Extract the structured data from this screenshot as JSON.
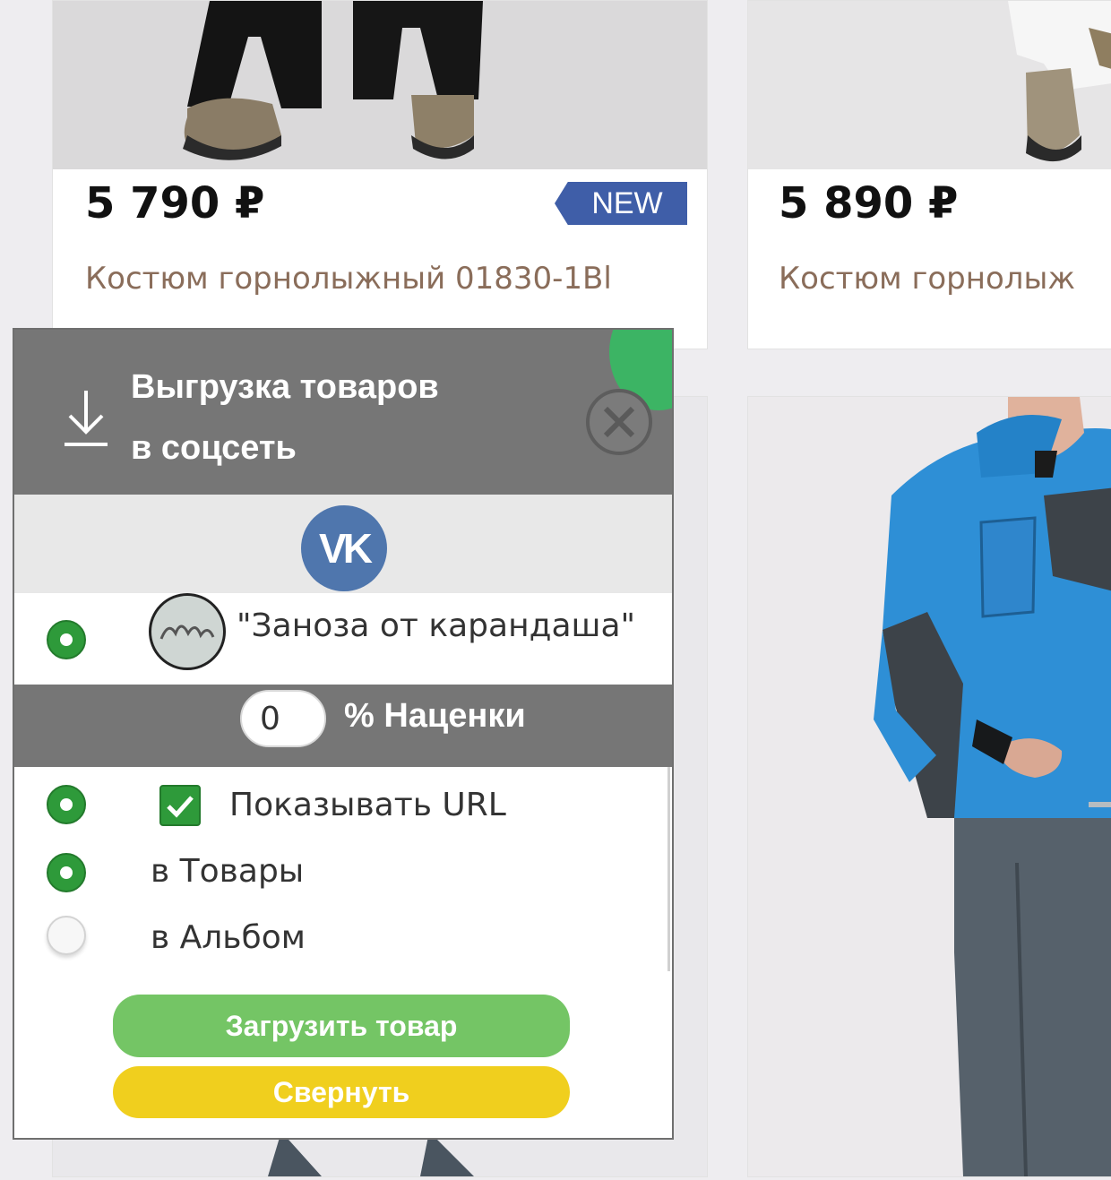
{
  "products": [
    {
      "price": "5 790 ₽",
      "name": "Костюм горнолыжный 01830-1Bl",
      "badge": "NEW"
    },
    {
      "price": "5 890 ₽",
      "name": "Костюм горнолыж"
    }
  ],
  "widget": {
    "title_line1": "Выгрузка товаров",
    "title_line2": "в соцсеть",
    "network_label": "VK",
    "group_name": "\"Заноза от карандаша\"",
    "markup_value": "0",
    "markup_label": "% Наценки",
    "show_url_label": "Показывать URL",
    "to_goods_label": "в Товары",
    "to_album_label": "в Альбом",
    "upload_button": "Загрузить товар",
    "collapse_button": "Свернуть"
  },
  "colors": {
    "header_gray": "#767676",
    "accent_green": "#2e9a3a",
    "upload_green": "#74c565",
    "collapse_yellow": "#f0cf1e",
    "vk_blue": "#4f76ad",
    "new_badge_blue": "#3f5ea8"
  },
  "icons": [
    "download-icon",
    "close-icon",
    "vk-logo-icon",
    "check-icon"
  ]
}
